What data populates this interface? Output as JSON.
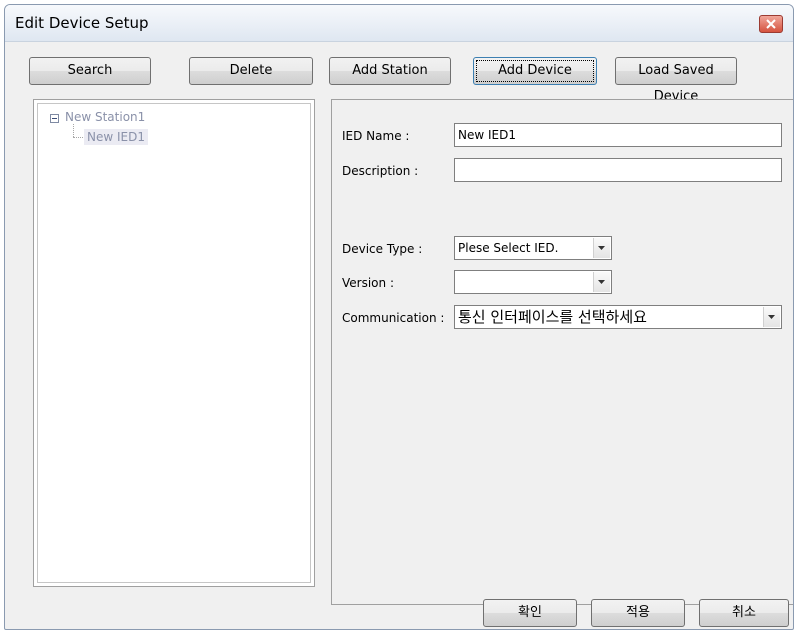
{
  "window": {
    "title": "Edit Device Setup"
  },
  "toolbar": {
    "search": "Search",
    "delete": "Delete",
    "add_station": "Add Station",
    "add_device": "Add Device",
    "load_saved_device": "Load Saved Device"
  },
  "tree": {
    "station": "New Station1",
    "device": "New IED1"
  },
  "form": {
    "ied_name_label": "IED Name :",
    "ied_name_value": "New IED1",
    "description_label": "Description :",
    "description_value": "",
    "device_type_label": "Device Type :",
    "device_type_value": "Plese Select IED.",
    "version_label": "Version :",
    "version_value": "",
    "communication_label": "Communication :",
    "communication_value": "통신 인터페이스를 선택하세요"
  },
  "footer": {
    "ok": "확인",
    "apply": "적용",
    "cancel": "취소"
  },
  "icons": {
    "close": "close-icon",
    "collapse": "minus-box-icon",
    "dropdown": "chevron-down-icon"
  },
  "colors": {
    "close_button": "#d5533f",
    "tree_text": "#8a91a9",
    "focus_border": "#3c7fb1"
  }
}
